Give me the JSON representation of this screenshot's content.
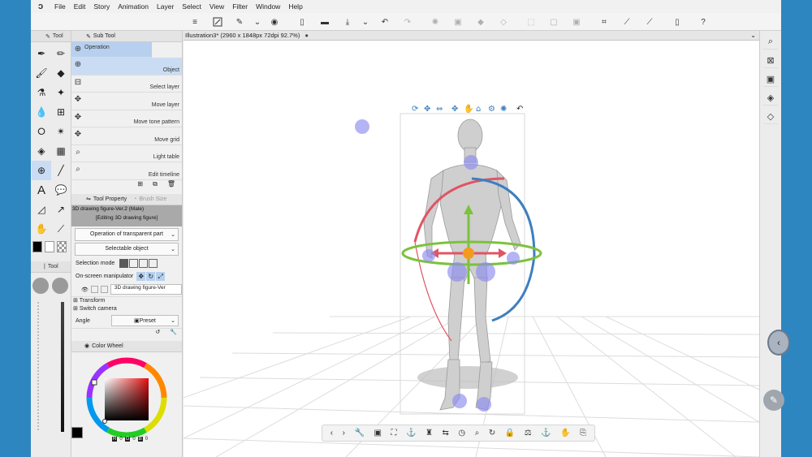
{
  "menu": [
    "File",
    "Edit",
    "Story",
    "Animation",
    "Layer",
    "Select",
    "View",
    "Filter",
    "Window",
    "Help"
  ],
  "panels": {
    "tool_title": "Tool",
    "subtool_title": "Sub Tool",
    "tool_property_title": "Tool Property",
    "brush_size_title": "Brush Size",
    "color_wheel_title": "Color Wheel",
    "tool2_title": "Tool"
  },
  "subtools": [
    {
      "label": "Operation",
      "icon": "operation-icon"
    },
    {
      "label": "Object",
      "icon": "object-icon"
    },
    {
      "label": "Select layer",
      "icon": "select-layer-icon"
    },
    {
      "label": "Move layer",
      "icon": "move-layer-icon"
    },
    {
      "label": "Move tone pattern",
      "icon": "move-tone-icon"
    },
    {
      "label": "Move grid",
      "icon": "move-grid-icon"
    },
    {
      "label": "Light table",
      "icon": "light-table-icon"
    },
    {
      "label": "Edit timeline",
      "icon": "edit-timeline-icon"
    }
  ],
  "tool_property": {
    "object_name": "3D drawing figure-Ver.2 (Male)",
    "editing_label": "[Editing 3D drawing figure]",
    "operation_dropdown": "Operation of transparent part",
    "selectable_dropdown": "Selectable object",
    "selection_mode_label": "Selection mode",
    "onscreen_label": "On-screen manipulator",
    "layer_dropdown": "3D drawing figure-Ver",
    "transform_label": "Transform",
    "switch_camera_label": "Switch camera",
    "angle_label": "Angle",
    "preset_label": "Preset"
  },
  "color_values": {
    "r": "0",
    "g": "0",
    "b": "0"
  },
  "document_tab": "Illustration3* (2960 x 1848px 72dpi 92.7%)",
  "colors": {
    "accent": "#c9dcf3",
    "red_ring": "#e05565",
    "blue_ring": "#3d7fc0",
    "green_ring": "#7cc23c",
    "handle": "#f39a1f"
  }
}
